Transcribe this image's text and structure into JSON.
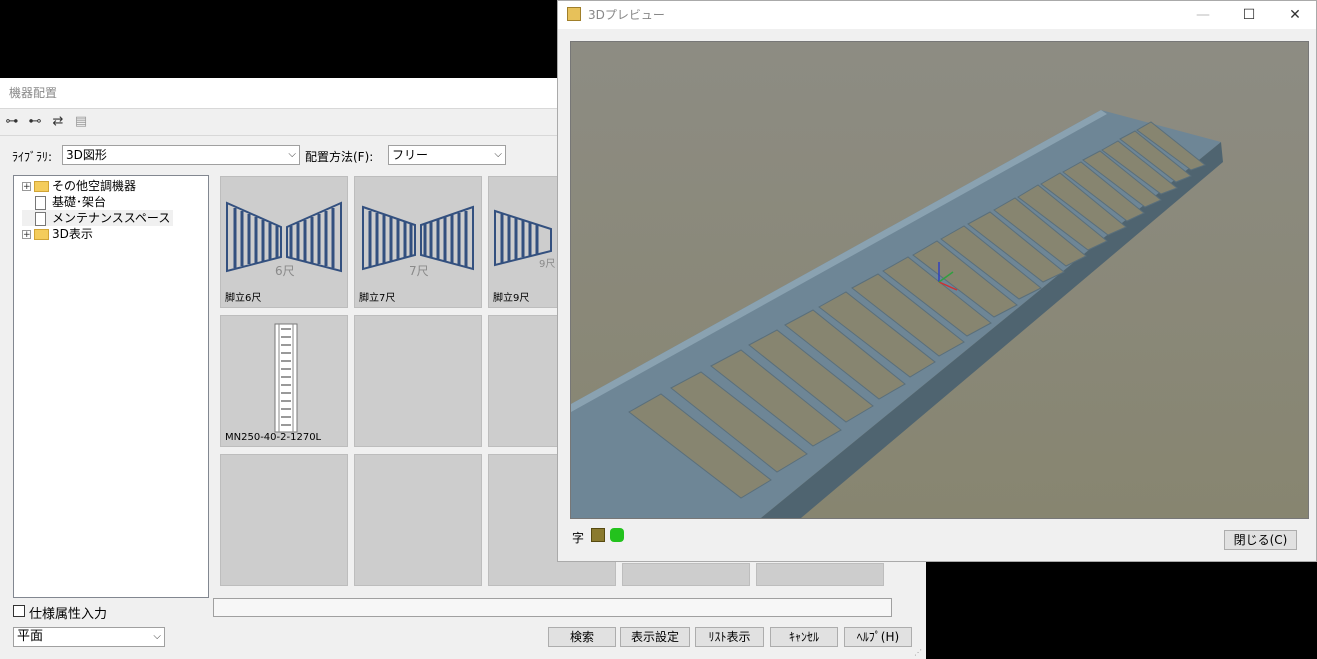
{
  "main_window": {
    "title": "機器配置",
    "library_label": "ﾗｲﾌﾞﾗﾘ:",
    "library_value": "3D図形",
    "placement_label": "配置方法(F):",
    "placement_value": "フリー",
    "tree": [
      {
        "label": "その他空調機器",
        "type": "folder",
        "expander": "+"
      },
      {
        "label": "基礎･架台",
        "type": "doc"
      },
      {
        "label": "メンテナンススペース",
        "type": "doc"
      },
      {
        "label": "3D表示",
        "type": "folder",
        "expander": "+"
      }
    ],
    "cells": [
      {
        "caption": "脚立6尺",
        "mark": "6尺"
      },
      {
        "caption": "脚立7尺",
        "mark": "7尺"
      },
      {
        "caption": "脚立9尺",
        "mark": "9尺"
      },
      {
        "caption": "MN250-40-2-1270L"
      }
    ],
    "spec_checkbox_label": "仕様属性入力",
    "view_value": "平面",
    "buttons": {
      "search": "検索",
      "display_settings": "表示設定",
      "list_view": "ﾘｽﾄ表示",
      "cancel": "ｷｬﾝｾﾙ",
      "help": "ﾍﾙﾌﾟ(H)"
    }
  },
  "preview_window": {
    "title": "3Dプレビュー",
    "footer_char": "字",
    "close_button": "閉じる(C)"
  },
  "colors": {
    "window_bg": "#f0f0f0",
    "thumbnail_bg": "#cdcdcd",
    "ladder_blue": "#33507f",
    "tray_steel": "#6e8696",
    "viewport_bg": "#8c8a7c"
  }
}
